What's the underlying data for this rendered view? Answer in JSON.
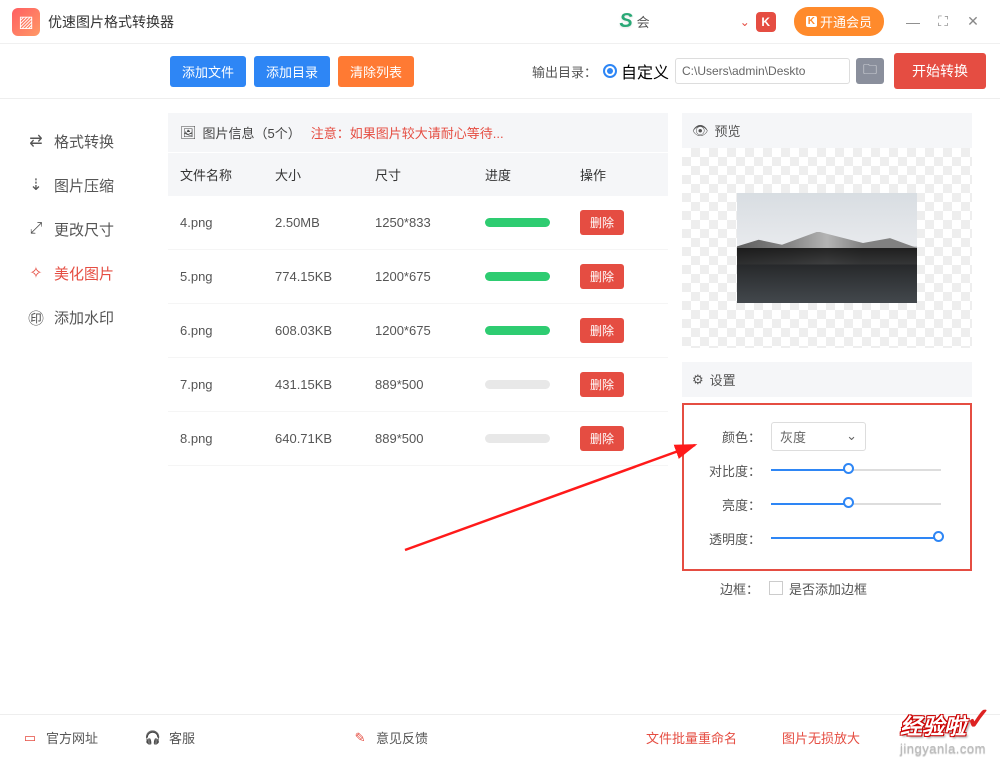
{
  "app": {
    "title": "优速图片格式转换器"
  },
  "titlebar": {
    "user_label": "会",
    "vip_label": "开通会员"
  },
  "toolbar": {
    "add_file": "添加文件",
    "add_dir": "添加目录",
    "clear_list": "清除列表",
    "output_label": "输出目录：",
    "custom_label": "自定义",
    "path": "C:\\Users\\admin\\Deskto",
    "start": "开始转换"
  },
  "sidebar": {
    "items": [
      {
        "icon": "⇄",
        "label": "格式转换"
      },
      {
        "icon": "⇣",
        "label": "图片压缩"
      },
      {
        "icon": "⤢",
        "label": "更改尺寸"
      },
      {
        "icon": "✧",
        "label": "美化图片"
      },
      {
        "icon": "㊞",
        "label": "添加水印"
      }
    ],
    "active_index": 3
  },
  "fileinfo": {
    "header_prefix": "图片信息（5个）",
    "header_warn": "注意：如果图片较大请耐心等待...",
    "cols": {
      "name": "文件名称",
      "size": "大小",
      "dim": "尺寸",
      "prog": "进度",
      "act": "操作"
    },
    "rows": [
      {
        "name": "4.png",
        "size": "2.50MB",
        "dim": "1250*833",
        "done": true
      },
      {
        "name": "5.png",
        "size": "774.15KB",
        "dim": "1200*675",
        "done": true
      },
      {
        "name": "6.png",
        "size": "608.03KB",
        "dim": "1200*675",
        "done": true
      },
      {
        "name": "7.png",
        "size": "431.15KB",
        "dim": "889*500",
        "done": false
      },
      {
        "name": "8.png",
        "size": "640.71KB",
        "dim": "889*500",
        "done": false
      }
    ],
    "delete_label": "删除"
  },
  "preview": {
    "title": "预览"
  },
  "settings": {
    "title": "设置",
    "color_label": "颜色：",
    "color_value": "灰度",
    "contrast_label": "对比度：",
    "contrast_pct": 45,
    "brightness_label": "亮度：",
    "brightness_pct": 45,
    "opacity_label": "透明度：",
    "opacity_pct": 100,
    "border_label": "边框：",
    "border_chk_label": "是否添加边框"
  },
  "bottom": {
    "official": "官方网址",
    "cs": "客服",
    "feedback": "意见反馈",
    "rename": "文件批量重命名",
    "enlarge": "图片无损放大"
  },
  "wm": {
    "top": "经验啦",
    "sub": "jingyanla.com"
  }
}
